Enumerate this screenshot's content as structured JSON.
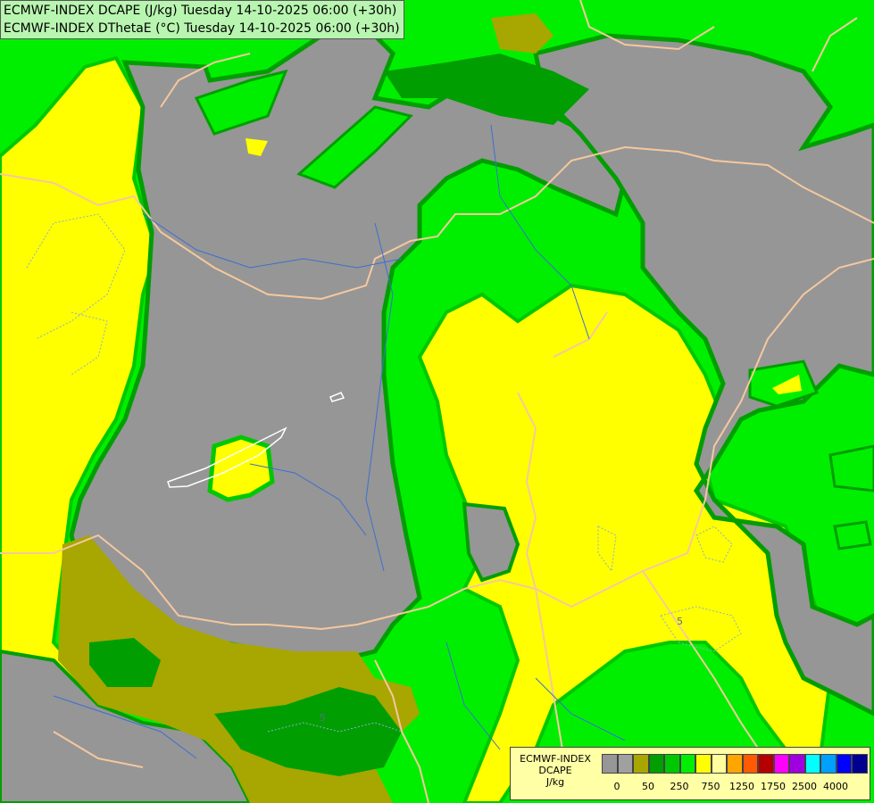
{
  "map": {
    "title_lines": [
      "ECMWF-INDEX DCAPE (J/kg) Tuesday 14-10-2025 06:00 (+30h)",
      "ECMWF-INDEX DThetaE (°C) Tuesday 14-10-2025 06:00 (+30h)"
    ],
    "contour_labels": [
      "5",
      "5"
    ],
    "colors": {
      "gray": "#969696",
      "olive": "#a8a600",
      "dark_green": "#009e00",
      "mid_green": "#00c800",
      "bright_green": "#00ef00",
      "yellow": "#ffff00",
      "border": "#f5c89e",
      "river": "#3c6fd0",
      "lake": "#ffffff"
    }
  },
  "legend": {
    "title_lines": [
      "ECMWF-INDEX",
      "DCAPE",
      "J/kg"
    ],
    "swatch_colors": [
      "#969696",
      "#a0a0a0",
      "#a8a600",
      "#009e00",
      "#00c800",
      "#00ef00",
      "#ffff00",
      "#ffff9e",
      "#ffa500",
      "#ff5a00",
      "#b40000",
      "#ff00ff",
      "#a000e0",
      "#00ffff",
      "#00a0ff",
      "#0000ff",
      "#000090"
    ],
    "tick_labels": [
      "0",
      "50",
      "250",
      "750",
      "1250",
      "1750",
      "2500",
      "4000"
    ]
  }
}
